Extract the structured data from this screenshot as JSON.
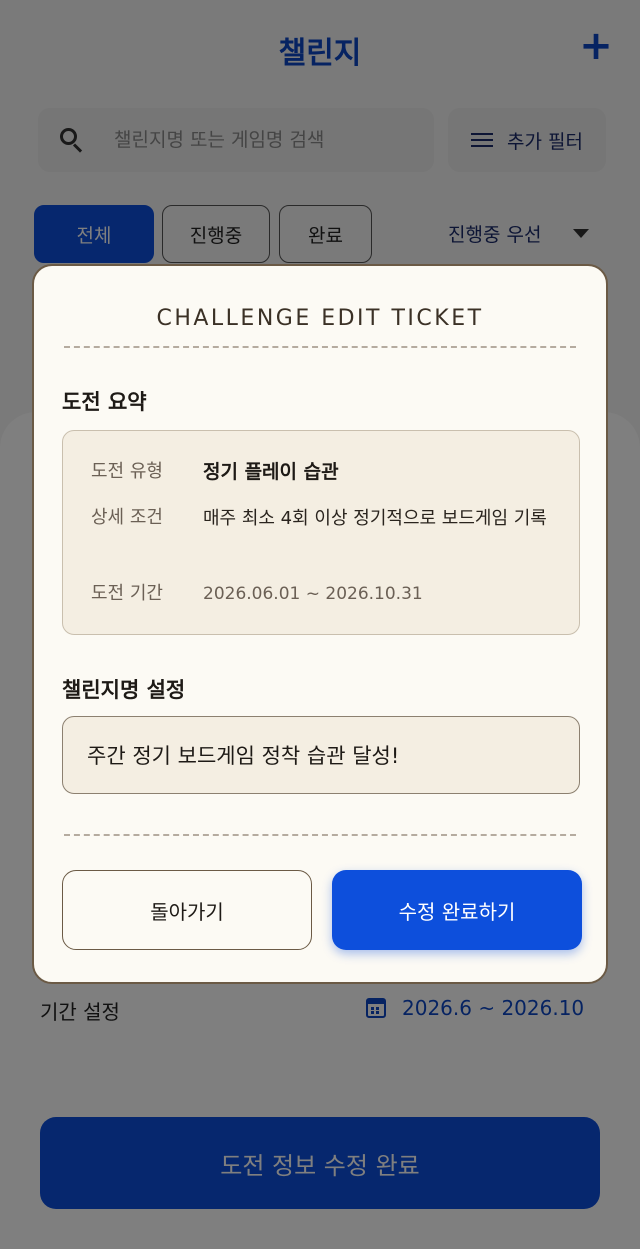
{
  "header": {
    "title": "챌린지",
    "add_label": "+"
  },
  "search": {
    "placeholder": "챌린지명 또는 게임명 검색"
  },
  "filter": {
    "label": "추가 필터"
  },
  "tabs": [
    {
      "label": "전체",
      "active": true
    },
    {
      "label": "진행중",
      "active": false
    },
    {
      "label": "완료",
      "active": false
    }
  ],
  "sort": {
    "label": "진행중 우선"
  },
  "period": {
    "label": "기간 설정",
    "value": "2026.6 ~ 2026.10"
  },
  "bottom_button": {
    "label": "도전 정보 수정 완료"
  },
  "modal": {
    "title": "CHALLENGE EDIT TICKET",
    "summary_title": "도전 요약",
    "summary": {
      "type_key": "도전 유형",
      "type_value": "정기 플레이 습관",
      "condition_key": "상세 조건",
      "condition_value": "매주 최소 4회 이상 정기적으로 보드게임 기록",
      "period_key": "도전 기간",
      "period_value": "2026.06.01 ~ 2026.10.31"
    },
    "name_title": "챌린지명 설정",
    "name_value": "주간 정기 보드게임 정착 습관 달성!",
    "back_label": "돌아가기",
    "confirm_label": "수정 완료하기"
  },
  "colors": {
    "accent": "#0d4fdc",
    "ticket_bg": "#fcfaf4",
    "ticket_border": "#6b5a45"
  }
}
